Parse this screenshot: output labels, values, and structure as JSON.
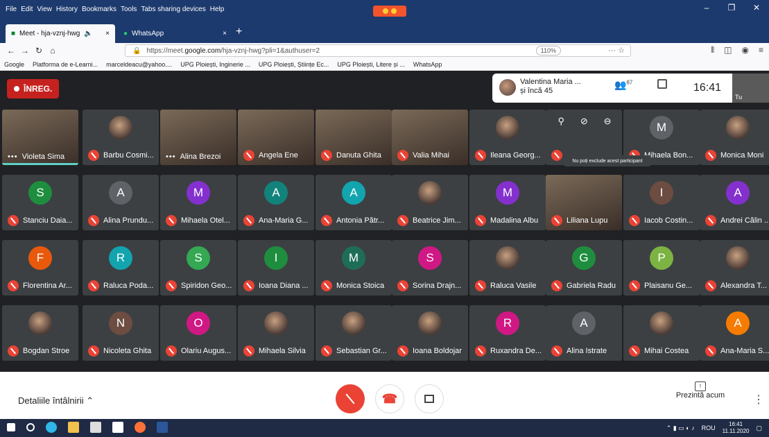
{
  "menu": [
    "File",
    "Edit",
    "View",
    "History",
    "Bookmarks",
    "Tools",
    "Tabs sharing devices",
    "Help"
  ],
  "tabs": [
    {
      "label": "Meet - hja-vznj-hwg",
      "close": "×"
    },
    {
      "label": "WhatsApp",
      "close": "×"
    }
  ],
  "url": {
    "prefix": "https://meet.",
    "domain": "google.com",
    "path": "/hja-vznj-hwg?pli=1&authuser=2",
    "zoom": "110%"
  },
  "bookmarks": [
    "Google",
    "Platforma de e-Learni...",
    "marceldeacu@yahoo....",
    "UPG Ploiești, Inginerie ...",
    "UPG Ploiești, Științe Ec...",
    "UPG Ploiești, Litere și ...",
    "WhatsApp"
  ],
  "meet": {
    "record_label": "ÎNREG.",
    "host_line1": "Valentina Maria ...",
    "host_line2": "și încă 45",
    "people_count": "87",
    "time": "16:41",
    "self_label": "Tu",
    "tooltip": "Nu poți exclude acest participant"
  },
  "participants": [
    [
      "Violeta Sima",
      "Barbu Cosmi...",
      "Alina Brezoi",
      "Angela Ene",
      "Danuta Ghita",
      "Valia Mihai",
      "Ileana Georg...",
      "",
      "Mihaela Bon...",
      "Monica Moni"
    ],
    [
      "Stanciu Daia...",
      "Alina Prundu...",
      "Mihaela Otel...",
      "Ana-Maria G...",
      "Antonia Pătr...",
      "Beatrice Jim...",
      "Madalina Albu",
      "Liliana Lupu",
      "Iacob Costin...",
      "Andrei Călin ..."
    ],
    [
      "Florentina Ar...",
      "Raluca Poda...",
      "Spiridon Geo...",
      "Ioana Diana ...",
      "Monica Stoica",
      "Sorina Drajn...",
      "Raluca Vasile",
      "Gabriela Radu",
      "Plaisanu Ge...",
      "Alexandra T..."
    ],
    [
      "Bogdan Stroe",
      "Nicoleta Ghita",
      "Olariu Augus...",
      "Mihaela Silvia",
      "Sebastian Gr...",
      "Ioana Boldojar",
      "Ruxandra De...",
      "Alina Istrate",
      "Mihai Costea",
      "Ana-Maria S..."
    ]
  ],
  "initials": [
    [
      "",
      "",
      "",
      "",
      "",
      "",
      "",
      "",
      "M",
      ""
    ],
    [
      "S",
      "A",
      "M",
      "A",
      "A",
      "",
      "M",
      "",
      "I",
      "A"
    ],
    [
      "F",
      "R",
      "S",
      "I",
      "M",
      "S",
      "",
      "G",
      "P",
      ""
    ],
    [
      "",
      "N",
      "O",
      "",
      "",
      "",
      "R",
      "A",
      "",
      "A"
    ]
  ],
  "avatar_colors": [
    [
      "",
      "",
      "",
      "",
      "",
      "",
      "",
      "",
      "#5f6368",
      ""
    ],
    [
      "#1e8e3e",
      "#5f6368",
      "#8430ce",
      "#12837b",
      "#12a4af",
      "",
      "#8430ce",
      "",
      "#6d4c41",
      "#8430ce"
    ],
    [
      "#e8590c",
      "#12a4af",
      "#34a853",
      "#1e8e3e",
      "#1e6e57",
      "#d01884",
      "",
      "#1e8e3e",
      "#7cb342",
      ""
    ],
    [
      "",
      "#6d4c41",
      "#d01884",
      "",
      "",
      "",
      "#d01884",
      "#5f6368",
      "",
      "#f57c00"
    ]
  ],
  "bottom": {
    "details": "Detaliile întâlnirii",
    "present": "Prezintă acum"
  },
  "taskbar": {
    "lang": "ROU",
    "time": "16:41",
    "date": "11.11.2020"
  }
}
